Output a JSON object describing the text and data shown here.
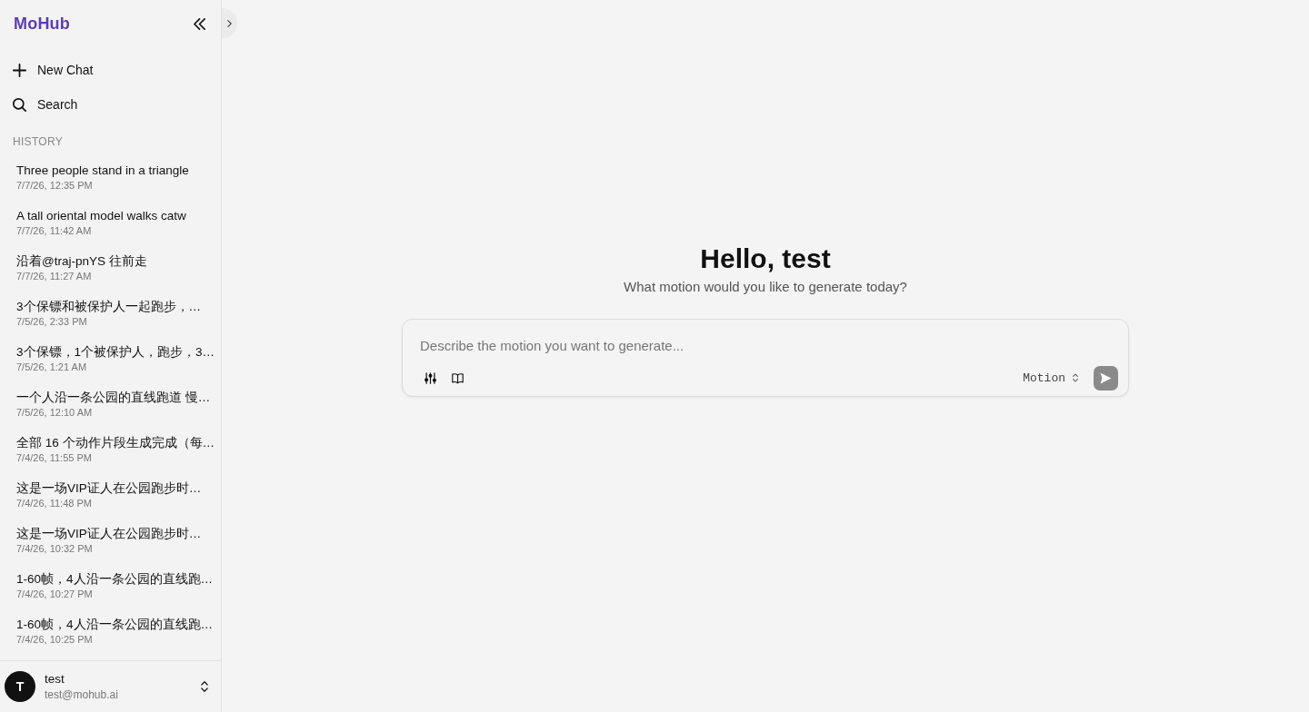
{
  "sidebar": {
    "logo": "MoHub",
    "actions": [
      {
        "kind": "new",
        "label": "New Chat"
      },
      {
        "kind": "search",
        "label": "Search"
      }
    ],
    "history_heading": "HISTORY",
    "history": [
      {
        "title": "Three people stand in a triangle",
        "time": "7/7/26, 12:35 PM"
      },
      {
        "title": "A tall oriental model walks catw",
        "time": "7/7/26, 11:42 AM"
      },
      {
        "title": "沿着@traj-pnYS 往前走",
        "time": "7/7/26, 11:27 AM"
      },
      {
        "title": "3个保镖和被保护人一起跑步，…",
        "time": "7/5/26, 2:33 PM"
      },
      {
        "title": "3个保镖，1个被保护人，跑步，3…",
        "time": "7/5/26, 1:21 AM"
      },
      {
        "title": "一个人沿一条公园的直线跑道 慢…",
        "time": "7/5/26, 12:10 AM"
      },
      {
        "title": "全部 16 个动作片段生成完成（每…",
        "time": "7/4/26, 11:55 PM"
      },
      {
        "title": "这是一场VIP证人在公园跑步时…",
        "time": "7/4/26, 11:48 PM"
      },
      {
        "title": "这是一场VIP证人在公园跑步时…",
        "time": "7/4/26, 10:32 PM"
      },
      {
        "title": "1-60帧，4人沿一条公园的直线跑…",
        "time": "7/4/26, 10:27 PM"
      },
      {
        "title": "1-60帧，4人沿一条公园的直线跑…",
        "time": "7/4/26, 10:25 PM"
      }
    ],
    "user": {
      "initial": "T",
      "name": "test",
      "email": "test@mohub.ai"
    }
  },
  "main": {
    "greeting": "Hello, test",
    "subtitle": "What motion would you like to generate today?",
    "composer": {
      "placeholder": "Describe the motion you want to generate...",
      "mode": "Motion",
      "send": {
        "disabled": true
      }
    }
  }
}
